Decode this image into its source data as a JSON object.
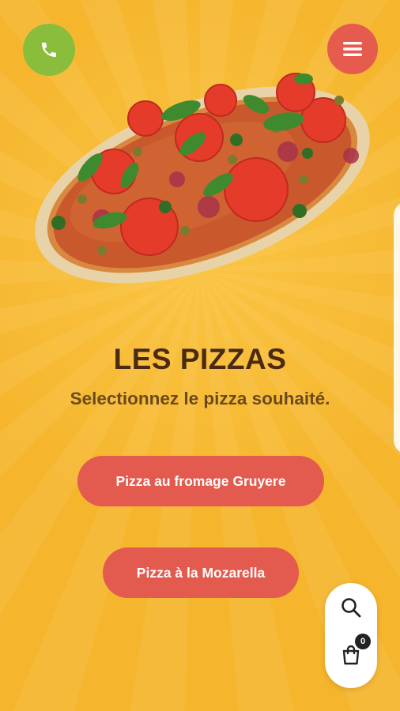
{
  "header": {
    "phone_icon": "phone-icon",
    "menu_icon": "hamburger-menu-icon",
    "phone_color": "#8bbd3c",
    "menu_color": "#e55c4f"
  },
  "hero": {
    "image": "pizza-image",
    "title": "LES PIZZAS",
    "subtitle": "Selectionnez le pizza souhaité."
  },
  "options": [
    {
      "label": "Pizza au fromage Gruyere"
    },
    {
      "label": "Pizza à la Mozarella"
    }
  ],
  "floating_actions": {
    "search_icon": "search-icon",
    "cart_icon": "shopping-bag-icon",
    "cart_count": "0"
  },
  "colors": {
    "background": "#f5b52c",
    "accent": "#e35a4f",
    "title": "#4a2a12"
  }
}
